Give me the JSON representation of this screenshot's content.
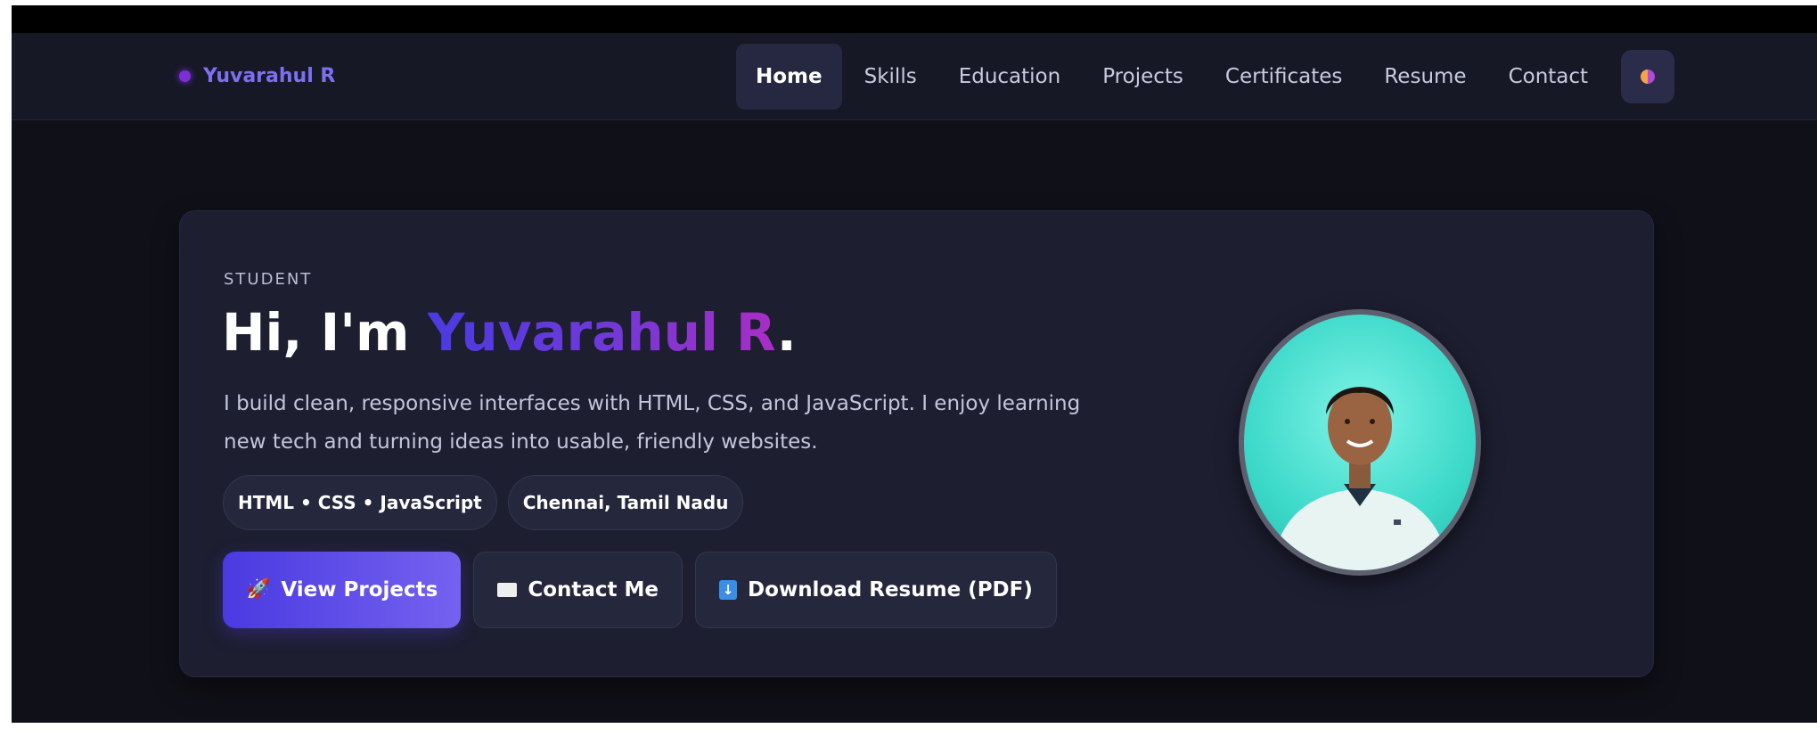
{
  "brand": {
    "name": "Yuvarahul R",
    "dot_color": "#7b2fd6"
  },
  "nav": {
    "links": [
      {
        "label": "Home",
        "active": true
      },
      {
        "label": "Skills",
        "active": false
      },
      {
        "label": "Education",
        "active": false
      },
      {
        "label": "Projects",
        "active": false
      },
      {
        "label": "Certificates",
        "active": false
      },
      {
        "label": "Resume",
        "active": false
      },
      {
        "label": "Contact",
        "active": false
      }
    ],
    "theme_toggle_icon": "half-moon-icon"
  },
  "hero": {
    "kicker": "STUDENT",
    "greeting": "Hi, I'm ",
    "name": "Yuvarahul R",
    "period": ".",
    "bio": "I build clean, responsive interfaces with HTML, CSS, and JavaScript. I enjoy learning new tech and turning ideas into usable, friendly websites.",
    "chips": [
      "HTML • CSS • JavaScript",
      "Chennai, Tamil Nadu"
    ],
    "buttons": {
      "view_projects": {
        "icon": "rocket-icon",
        "label": "View Projects"
      },
      "contact_me": {
        "icon": "envelope-icon",
        "label": "Contact Me"
      },
      "download_resume": {
        "icon": "download-icon",
        "label": "Download Resume (PDF)"
      }
    },
    "photo": "profile-photo"
  },
  "colors": {
    "accent_start": "#4a3be0",
    "accent_end": "#a92ec4",
    "background": "#101018",
    "card": "#1d1e30"
  }
}
